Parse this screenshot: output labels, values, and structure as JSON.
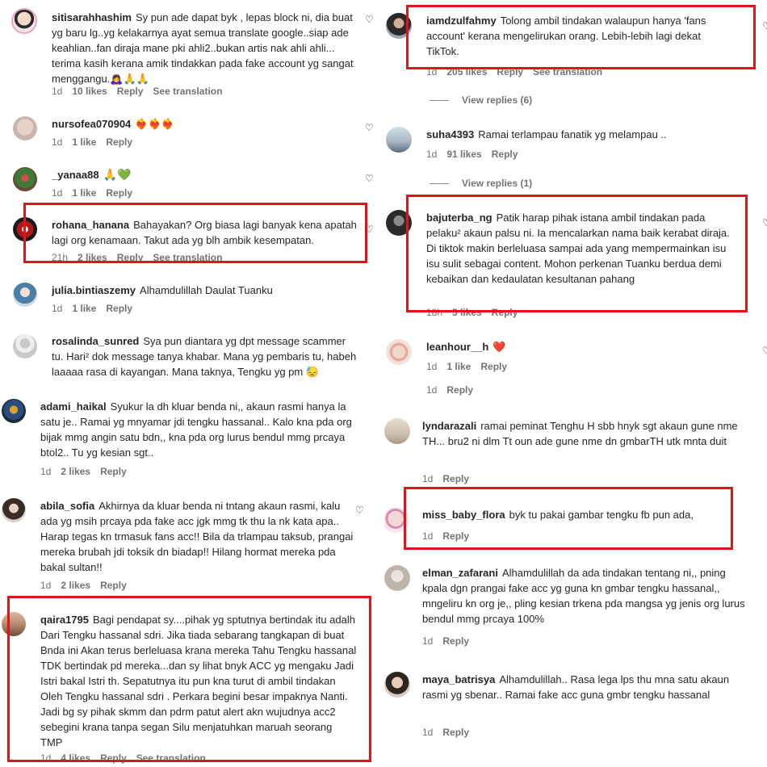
{
  "colors": {
    "highlight": "#e0141b",
    "text": "#262626",
    "muted": "#737373",
    "heart_red": "#e0243b"
  },
  "icons": {
    "like": "heart-outline-icon"
  },
  "left_top": [
    {
      "username": "sitisarahhashim",
      "text": "Sy pun ade dapat byk , lepas block ni, dia buat yg baru lg..yg kelakarnya ayat semua translate google..siap ade keahlian..fan diraja mane pki ahli2..bukan artis nak ahli ahli... terima kasih kerana amik tindakkan pada fake account yg sangat menggangu.🙇‍♀️🙏🙏",
      "time": "1d",
      "likes": "10 likes",
      "reply": "Reply",
      "translate": "See translation"
    },
    {
      "username": "nursofea070904",
      "text": "❤️‍🔥❤️‍🔥❤️‍🔥",
      "time": "1d",
      "likes": "1 like",
      "reply": "Reply"
    },
    {
      "username": "_yanaa88",
      "text": "🙏💚",
      "time": "1d",
      "likes": "1 like",
      "reply": "Reply"
    },
    {
      "username": "rohana_hanana",
      "text": "Bahayakan? Org biasa lagi banyak kena apatah lagi org kenamaan. Takut ada yg blh ambik kesempatan.",
      "time": "21h",
      "likes": "2 likes",
      "reply": "Reply",
      "translate": "See translation"
    },
    {
      "username": "julia.bintiaszemy",
      "text": "Alhamdulillah Daulat Tuanku",
      "time": "1d",
      "likes": "1 like",
      "reply": "Reply"
    },
    {
      "username": "rosalinda_sunred",
      "text": "Sya pun diantara yg dpt message scammer tu. Hari² dok message tanya khabar. Mana yg pembaris tu, habeh laaaaa rasa di kayangan. Mana taknya, Tengku yg pm 😓"
    }
  ],
  "left_bottom": [
    {
      "username": "adami_haikal",
      "text": "Syukur la dh kluar benda ni,, akaun rasmi hanya la satu je.. Ramai yg mnyamar jdi tengku hassanal.. Kalo kna pda org bijak mmg angin satu bdn,, kna pda org lurus bendul mmg prcaya btol2.. Tu yg kesian sgt..",
      "time": "1d",
      "likes": "2 likes",
      "reply": "Reply"
    },
    {
      "username": "abila_sofia",
      "text": "Akhirnya da kluar benda ni tntang akaun rasmi, kalu ada yg msih prcaya pda fake acc jgk mmg tk thu la nk kata apa.. Harap tegas kn trmasuk fans acc!! Bila da trlampau taksub, prangai mereka brubah jdi toksik dn biadap!! Hilang hormat mereka pda bakal sultan!!",
      "time": "1d",
      "likes": "2 likes",
      "reply": "Reply"
    },
    {
      "username": "qaira1795",
      "text": "Bagi pendapat sy....pihak yg sptutnya bertindak itu adalh Dari Tengku hassanal sdri. Jika tiada sebarang tangkapan di buat Bnda ini Akan terus berleluasa krana mereka Tahu Tengku hassanal TDK bertindak pd mereka...dan sy lihat bnyk ACC yg mengaku Jadi Istri bakal Istri th. Sepatutnya itu pun kna turut di ambil tindakan Oleh Tengku hassanal sdri . Perkara begini besar impaknya Nanti. Jadi bg sy pihak skmm dan pdrm patut alert akn wujudnya acc2 sebegini krana tanpa segan Silu menjatuhkan maruah seorang TMP",
      "time": "1d",
      "likes": "4 likes",
      "reply": "Reply",
      "translate": "See translation"
    }
  ],
  "right_top": [
    {
      "username": "iamdzulfahmy",
      "text": "Tolong ambil tindakan walaupun hanya 'fans account' kerana mengelirukan orang. Lebih-lebih lagi dekat TikTok.",
      "time": "1d",
      "likes": "205 likes",
      "reply": "Reply",
      "translate": "See translation",
      "view_replies": "View replies (6)"
    },
    {
      "username": "suha4393",
      "text": "Ramai terlampau fanatik yg melampau ..",
      "time": "1d",
      "likes": "91 likes",
      "reply": "Reply",
      "view_replies": "View replies (1)"
    },
    {
      "username": "bajuterba_ng",
      "text": "Patik harap pihak istana ambil tindakan pada pelaku² akaun palsu ni. Ia mencalarkan nama baik kerabat diraja. Di tiktok makin berleluasa sampai ada yang mempermainkan isu isu sulit sebagai content. Mohon perkenan Tuanku berdua demi kebaikan dan kedaulatan kesultanan pahang",
      "time": "18h",
      "likes": "5 likes",
      "reply": "Reply"
    },
    {
      "username": "leanhour__h",
      "text": "❤️",
      "time": "1d",
      "likes": "1 like",
      "reply": "Reply"
    },
    {
      "time": "1d",
      "reply": "Reply"
    }
  ],
  "right_bottom": [
    {
      "username": "lyndarazali",
      "text": "ramai peminat Tenghu H sbb hnyk sgt akaun gune nme TH... bru2 ni dlm Tt oun ade gune nme dn gmbarTH utk mnta duit",
      "time": "1d",
      "reply": "Reply"
    },
    {
      "username": "miss_baby_flora",
      "text": "byk tu pakai gambar tengku fb pun ada,",
      "time": "1d",
      "reply": "Reply"
    },
    {
      "username": "elman_zafarani",
      "text": "Alhamdulillah da ada tindakan tentang ni,, pning kpala dgn prangai fake acc yg guna kn gmbar tengku hassanal,, mngeliru kn org je,, pling kesian trkena pda mangsa yg jenis org lurus bendul mmg prcaya 100%",
      "time": "1d",
      "reply": "Reply"
    },
    {
      "username": "maya_batrisya",
      "text": "Alhamdulillah.. Rasa lega lps thu mna satu akaun rasmi yg sbenar.. Ramai fake acc guna gmbr tengku hassanal",
      "time": "1d",
      "reply": "Reply"
    }
  ]
}
